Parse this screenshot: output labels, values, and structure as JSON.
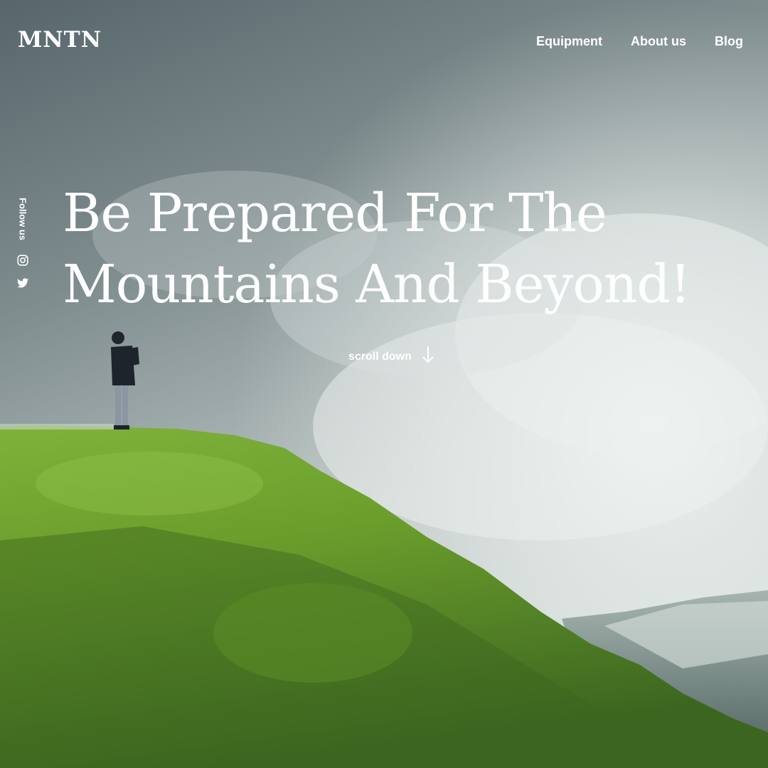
{
  "brand": {
    "logo": "MNTN"
  },
  "nav": {
    "items": [
      {
        "label": "Equipment"
      },
      {
        "label": "About us"
      },
      {
        "label": "Blog"
      }
    ]
  },
  "social": {
    "label": "Follow us",
    "icons": [
      "instagram-icon",
      "twitter-icon"
    ]
  },
  "hero": {
    "headline_line1": "Be Prepared For The",
    "headline_line2": "Mountains And Beyond!",
    "scroll_label": "scroll down",
    "scroll_icon": "arrow-down-icon"
  },
  "colors": {
    "text": "#ffffff",
    "sky_top": "#5f6e73",
    "sky_mid": "#a9b4b4",
    "cloud": "#e6ecea",
    "grass_light": "#8cbf3a",
    "grass_dark": "#3f6b1e"
  }
}
